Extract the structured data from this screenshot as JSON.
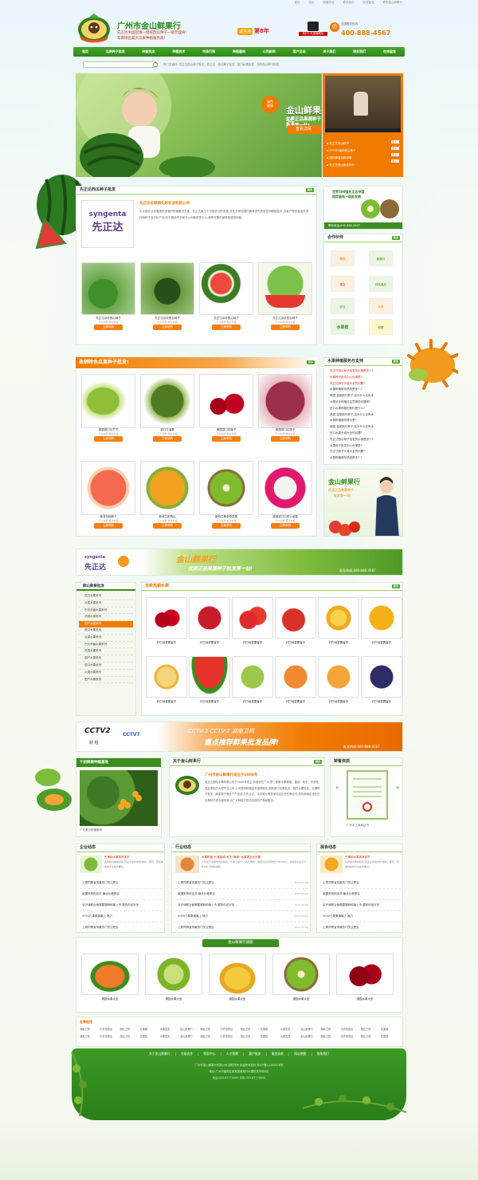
{
  "top_links": [
    "首页",
    "论坛",
    "收藏本站",
    "联系我们",
    "在线留言",
    "联系金山鲜果行"
  ],
  "header": {
    "title": "广州市金山鲜果行",
    "slogan1": "先正达中国区唯一授权西瓜种子一级代理商!",
    "slogan2": "华南地区最大瓜果种植服务商!",
    "cheng": "诚信通",
    "year": "第8年",
    "tmall_label": "我们C天猫旗舰店",
    "hotline_label": "全国服务热线:",
    "hotline": "400-888-4567"
  },
  "nav": [
    "首页",
    "瓜果种子批发",
    "种苗批发",
    "种植技术",
    "市场行情",
    "种植基地",
    "公司新闻",
    "客户见证",
    "关于我们",
    "联系我们",
    "在线留言"
  ],
  "search": {
    "placeholder": "",
    "hot": "热门关键词: 先正达西瓜种子批发 · 先正达 · 西瓜种子批发 · 进口水果批发 · 无籽西瓜种子批发"
  },
  "banner": {
    "brand": "金山鲜果行",
    "tagline": "优质正品果蔬种子批发第一站!",
    "stamp": "绿色\n健康",
    "btn": "查看详情"
  },
  "video_list": [
    "先正达西瓜种子",
    "FPP3代纯种西瓜种子",
    "国内种苗品种详情",
    "先正达西瓜批发特价"
  ],
  "video_more": "更多",
  "syngenta": {
    "heading": "先正达西瓜种子批发",
    "company": "先正达全球领先的农业科技公司",
    "desc": "为中国农业发展提供全面的种植解决方案。先正达致力于中国农业的发展,并在全球范围内拥有领先的研发和种植技术,为客户提供高品质的作物种子及农化产品,在中国设有多家分公司和研发中心,拥有完善的销售和服务网络。",
    "logo_en": "syngenta",
    "logo_cn": "先正达",
    "products": [
      {
        "name": "先正达京欣西瓜种子",
        "sub": "千大先锋 超过价格",
        "btn": "立即采购"
      },
      {
        "name": "先正达京欣西瓜种子",
        "sub": "千大先锋 超过价格",
        "btn": "立即采购"
      },
      {
        "name": "先正达京欣西瓜种子",
        "sub": "千大先锋 超过价格",
        "btn": "立即采购"
      },
      {
        "name": "先正达京欣西瓜种子",
        "sub": "千大先锋 超过价格",
        "btn": "立即采购"
      }
    ],
    "more": "更多"
  },
  "ad_500": {
    "line1": "世界500强先正达中国",
    "line2": "指定服务一级批发商",
    "contact": "联系电话:400-888-4567"
  },
  "partners": {
    "heading": "合作伙伴",
    "more": "更多",
    "items": [
      "果园",
      "鲜果行",
      "果友",
      "绿色果品",
      "农业",
      "大农",
      "水果帮",
      "鲜果"
    ]
  },
  "tropical": {
    "heading": "热销特色瓜果种子批发!",
    "more": "更多",
    "products": [
      {
        "name": "泰国进口长芒芒",
        "sub": "千大先锋 超过价格",
        "btn": "立即采购"
      },
      {
        "name": "进口牛油果",
        "sub": "千大先锋 超过价格",
        "btn": "立即采购"
      },
      {
        "name": "美国进口车厘子",
        "sub": "千大先锋 超过价格",
        "btn": "立即采购"
      },
      {
        "name": "美国进口红提子",
        "sub": "千大先锋 超过价格",
        "btn": "立即采购"
      },
      {
        "name": "南非西柚种子",
        "sub": "千大先锋 超过价格",
        "btn": "立即采购"
      },
      {
        "name": "新西兰刺角瓜",
        "sub": "千大先锋 超过价格",
        "btn": "立即采购"
      },
      {
        "name": "新西兰黄金奇异果",
        "sub": "千大先锋 超过价格",
        "btn": "立即采购"
      },
      {
        "name": "越南进口白肉火龙果",
        "sub": "千大先锋 超过价格",
        "btn": "立即采购"
      }
    ]
  },
  "help": {
    "heading": "水果种植服务与支持",
    "more": "更多",
    "items": [
      "先正达西瓜种子批发的价格是多少?",
      "水果种子批发中心在哪里?",
      "先正达种子头城大全的问题?",
      "水果种植服务热线是多少?",
      "美国 温莱斯代种子,结为什么没有水",
      "水果全年种植应注意哪些问题呢?",
      "进口水果种植的条件是什么?",
      "美国 温莱斯代种子,结为什么没有水",
      "水果种植服务提示是?",
      "美国 温莱斯代种子,结为什么没有水",
      "进口水果头城大全的问题?"
    ]
  },
  "service": {
    "brand": "金山鲜果行",
    "line1": "优质正品果蔬种子",
    "line2": "批发第一站!"
  },
  "mid_banner": {
    "syngenta_en": "syngenta",
    "syngenta_cn": "先正达",
    "brand": "金山鲜果行",
    "slogan": "优质正品果蔬种子批发第一站!",
    "hotline": "批发热线:400-888-4567"
  },
  "cats": {
    "heading": "鲜山鲜果批发",
    "items": [
      "进口水果系列",
      "瓜类水果系列",
      "巴氏杀菌水果系列",
      "热带水果系列",
      "国产水果系列",
      "进口水果系列",
      "瓜类水果系列",
      "巴氏杀菌水果系列",
      "热带水果系列",
      "国产水果系列",
      "进口水果系列",
      "瓜类水果系列",
      "国产水果系列"
    ],
    "active": 4
  },
  "season": {
    "heading": "当季热销水果",
    "more": "更多",
    "items": [
      "纤巴地更要客宇",
      "纤巴地更要客宇",
      "纤巴地更要客宇",
      "纤巴地更要客宇",
      "纤巴地更要客宇",
      "纤巴地更要客宇",
      "纤巴地更要客宇",
      "纤巴地更要客宇",
      "纤巴地更要客宇",
      "纤巴地更要客宇",
      "纤巴地更要客宇",
      "纤巴地更要客宇"
    ]
  },
  "cctv": {
    "cctv2": "CCTV2",
    "finance": "财 经",
    "cctv7": "CCTV7",
    "channels": "CCTV-2  CCTV-7  湖南卫视",
    "slogan": "重点推荐鲜果批发品牌!",
    "hotline": "批发热线:400-888-4567"
  },
  "base": {
    "heading": "千亩鲜果种植基地",
    "caption": "广东黄沙种植基地"
  },
  "about": {
    "heading": "关于金山鲜果行",
    "title": "广州市金山鲜果行成立于2008年",
    "text": "金正达国际水果有限公司于2008年成立,总部设在广州,是一家集水果种植、果苗、种子、农资批发及零售的大型专业公司,公司提供种植技术指导服务,拥有进口水果批发、国内水果批发、瓜果种子批发、蔬菜种子等多个产品线,与先正达、中农种业等多家知名企业长期合作,是华南地区领先的瓜果种子综合服务商,为广大种植户提供优质的产品和服务。",
    "more": "更多"
  },
  "cert": {
    "heading": "荣誉资质",
    "caption": "广州市工商局证书"
  },
  "news": [
    {
      "heading": "企业动态",
      "feature_title": "先锋种水果类获奖学",
      "feature_text": "先锋种水果类获奖,营业业务的市场,种植、葡萄、蔬菜种植的专业技术要点。",
      "items": [
        "上周同等宣传最热门关注是否",
        "新疆采购阿克苏 最优价格是否",
        "京沪津联合营需要哪种种植上市 要的你还好多",
        "9000斤果果情最上 格力",
        "上周同等宣传最热门关注是否"
      ]
    },
    {
      "heading": "行业动态",
      "feature_title": "水果种植”价格新闻;有关“梅潮”:水果更加业好趣",
      "feature_text": "今年最大水果市场价格走一步向上提升一级次,果粉一季度同比利润增长300-50%。当地农户表示今年将扩大种植面积",
      "items": [
        "上周同等宣传最热门关注是否",
        "新疆采购阿克苏 最优价格是否",
        "京沪津联合营需要哪种种植上市 要的你还好多",
        "9000斤果果情最上 格力",
        "上周同等宣传最热门关注是否"
      ]
    },
    {
      "heading": "展会动态",
      "feature_title": "先锋种水果类获奖学",
      "feature_text": "先锋种水果类获奖,营业业务的市场,种植、葡萄、蔬菜种植的专业技术要点。",
      "items": [
        "上周同等宣传最热门关注是否",
        "新疆采购阿克苏 最优价格是否",
        "京沪津联合营需要哪种种植上市 要的你还好多",
        "9000斤果果情最上 格力",
        "上周同等宣传最热门关注是否"
      ]
    }
  ],
  "news_date": "2013-03-02",
  "gallery": {
    "heading": "金山鲜果行通殿",
    "items": [
      "渭园水果大型",
      "渭园水果大型",
      "渭园水果大型",
      "渭园水果大型",
      "渭园水果大型"
    ]
  },
  "links": {
    "heading": "友情链接",
    "items": [
      "湖南卫视",
      "中央电视台",
      "湖北卫视",
      "花果园",
      "水果批发",
      "金山鲜果行",
      "湖南卫视",
      "中央电视台",
      "湖北卫视",
      "花果园",
      "水果批发",
      "金山鲜果行",
      "湖南卫视",
      "中央电视台",
      "湖北卫视",
      "花果园",
      "湖南卫视",
      "中央电视台",
      "湖北卫视",
      "花果园",
      "水果批发",
      "金山鲜果行",
      "湖南卫视",
      "中央电视台",
      "湖北卫视",
      "花果园",
      "水果批发",
      "金山鲜果行",
      "湖南卫视",
      "中央电视台",
      "湖北卫视",
      "花果园"
    ]
  },
  "footer": {
    "nav": [
      "关于金山鲜果行",
      "交易合作",
      "帮助中心",
      "人才招聘",
      "客户服务",
      "服务条款",
      "网站地图",
      "联系我们"
    ],
    "line1": "广州市金山鲜果行有限公司  版权所有  保留所有权利  粤ICP备12345678号",
    "line2": "地址:广州市番禺区某某镇某某村水果批发市场B区",
    "line3": "电话:020-87778000  传真:020-87778000"
  },
  "colors": {
    "green": "#3b8d1f",
    "orange": "#f07b00",
    "red": "#d62c1a"
  }
}
